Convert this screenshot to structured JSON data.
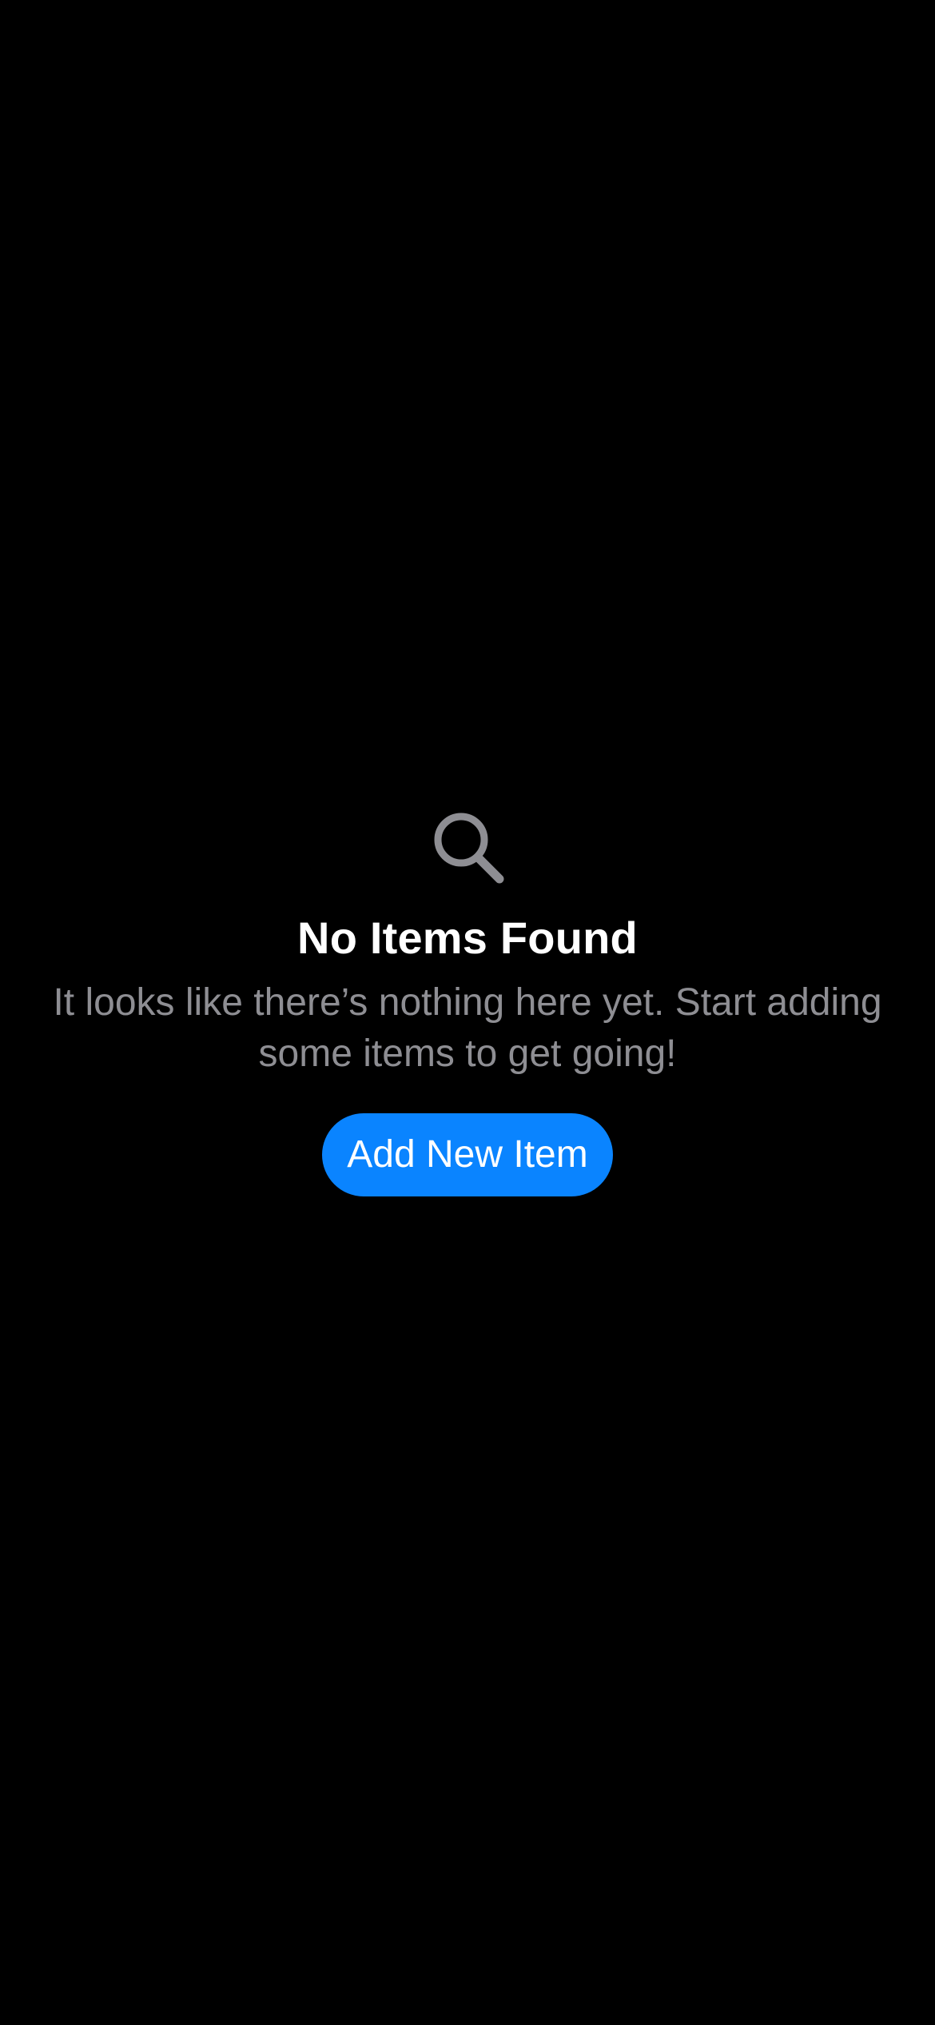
{
  "colors": {
    "background": "#000000",
    "title": "#ffffff",
    "message": "#8e8e93",
    "icon": "#8e8e93",
    "accent": "#0a84ff",
    "button_text": "#ffffff"
  },
  "empty_state": {
    "icon": "magnifying-glass-icon",
    "title": "No Items Found",
    "message": "It looks like there’s nothing here yet. Start adding some items to get going!",
    "button_label": "Add New Item"
  }
}
